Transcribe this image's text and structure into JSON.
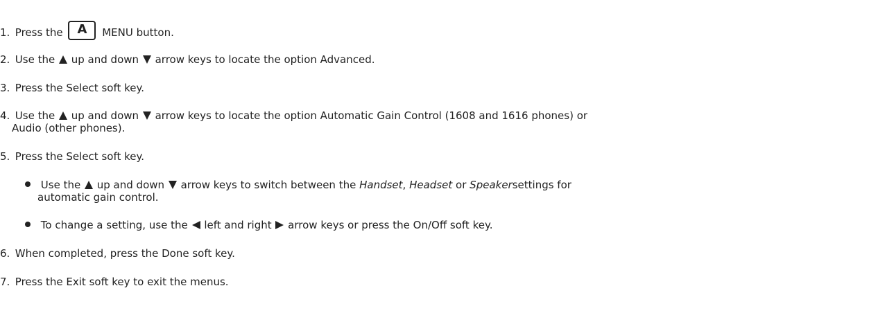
{
  "steps": {
    "s1": {
      "num": "1.",
      "pre": "Press the",
      "key": "A",
      "post": "MENU button."
    },
    "s2": {
      "num": "2.",
      "a": "Use the",
      "b": "up and down",
      "c": "arrow keys to locate the option Advanced."
    },
    "s3": {
      "num": "3.",
      "text": "Press the Select soft key."
    },
    "s4": {
      "num": "4.",
      "a": "Use the",
      "b": "up and down",
      "c": "arrow keys to locate the option Automatic Gain Control (1608 and 1616 phones) or",
      "line2": "Audio (other phones)."
    },
    "s5": {
      "num": "5.",
      "text": "Press the Select soft key."
    },
    "b1": {
      "a": "Use the",
      "b": "up and down",
      "c": "arrow keys to switch between the",
      "handset": "Handset",
      "comma": ",",
      "headset": "Headset",
      "or": "or",
      "speaker": "Speaker",
      "d": "settings for",
      "line2": "automatic gain control."
    },
    "b2": {
      "a": "To change a setting, use the",
      "b": "left and right",
      "c": "arrow keys or press the On/Off soft key."
    },
    "s6": {
      "num": "6.",
      "text": "When completed, press the Done soft key."
    },
    "s7": {
      "num": "7.",
      "text": "Press the Exit soft key to exit the menus."
    }
  },
  "icons": {
    "up": "up-arrow-icon",
    "down": "down-arrow-icon",
    "left": "left-arrow-icon",
    "right": "right-arrow-icon"
  }
}
